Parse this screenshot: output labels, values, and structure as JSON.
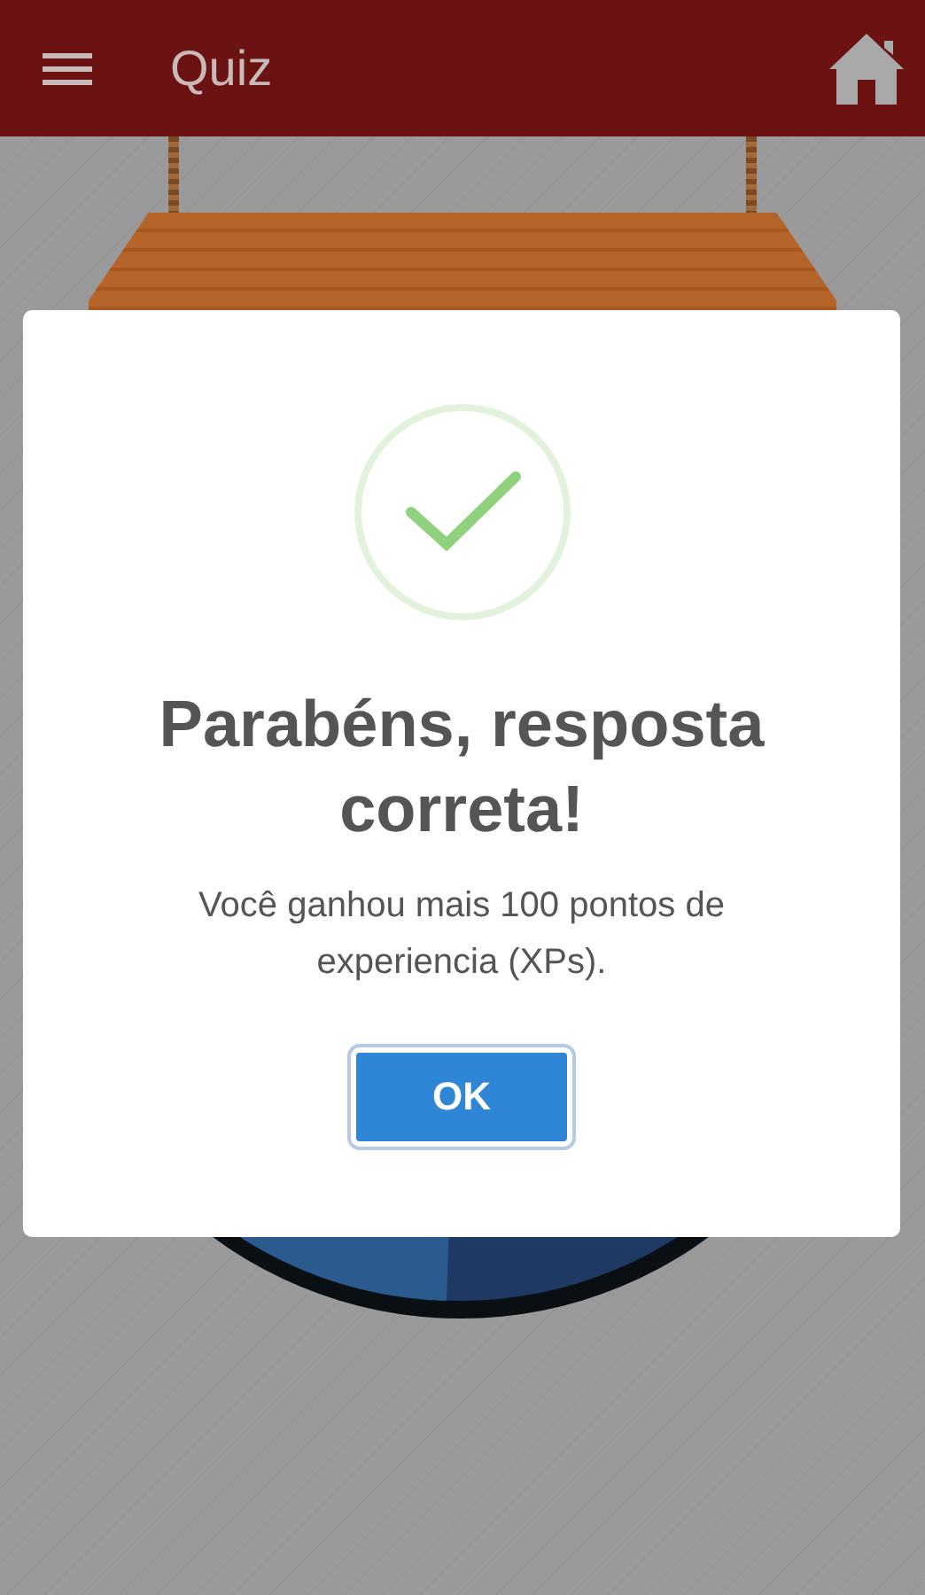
{
  "app_bar": {
    "title": "Quiz"
  },
  "dialog": {
    "title": "Parabéns, resposta correta!",
    "message": "Você ganhou mais 100 pontos de experiencia (XPs).",
    "button": "OK"
  }
}
